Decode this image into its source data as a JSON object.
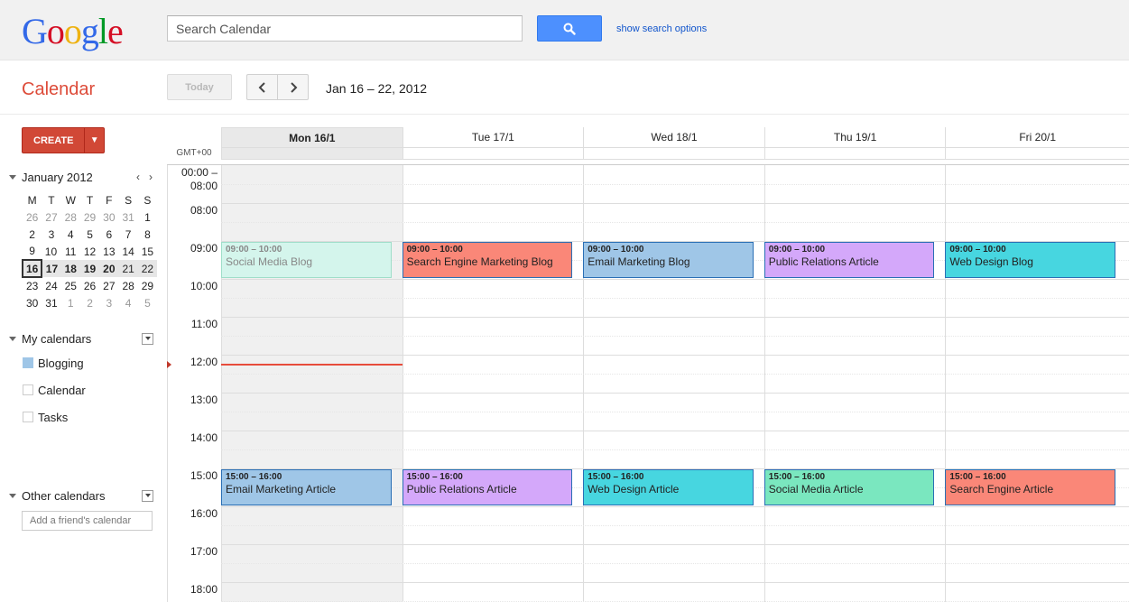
{
  "header": {
    "logo_letters": [
      {
        "ch": "G",
        "color": "#3369e8"
      },
      {
        "ch": "o",
        "color": "#d50f25"
      },
      {
        "ch": "o",
        "color": "#eeb211"
      },
      {
        "ch": "g",
        "color": "#3369e8"
      },
      {
        "ch": "l",
        "color": "#009925"
      },
      {
        "ch": "e",
        "color": "#d50f25"
      }
    ],
    "search_placeholder": "Search Calendar",
    "search_icon": "search-icon",
    "search_options_label": "show search options"
  },
  "toolbar": {
    "app_title": "Calendar",
    "today_label": "Today",
    "prev_icon": "chevron-left-icon",
    "next_icon": "chevron-right-icon",
    "date_range": "Jan 16 – 22, 2012"
  },
  "sidebar": {
    "create_label": "CREATE",
    "mini_calendar": {
      "title": "January 2012",
      "dows": [
        "M",
        "T",
        "W",
        "T",
        "F",
        "S",
        "S"
      ],
      "weeks": [
        [
          {
            "d": "26",
            "o": true
          },
          {
            "d": "27",
            "o": true
          },
          {
            "d": "28",
            "o": true
          },
          {
            "d": "29",
            "o": true
          },
          {
            "d": "30",
            "o": true
          },
          {
            "d": "31",
            "o": true
          },
          {
            "d": "1"
          }
        ],
        [
          {
            "d": "2"
          },
          {
            "d": "3"
          },
          {
            "d": "4"
          },
          {
            "d": "5"
          },
          {
            "d": "6"
          },
          {
            "d": "7"
          },
          {
            "d": "8"
          }
        ],
        [
          {
            "d": "9"
          },
          {
            "d": "10"
          },
          {
            "d": "11"
          },
          {
            "d": "12"
          },
          {
            "d": "13"
          },
          {
            "d": "14"
          },
          {
            "d": "15"
          }
        ],
        [
          {
            "d": "16",
            "today": true
          },
          {
            "d": "17"
          },
          {
            "d": "18"
          },
          {
            "d": "19"
          },
          {
            "d": "20"
          },
          {
            "d": "21"
          },
          {
            "d": "22"
          }
        ],
        [
          {
            "d": "23"
          },
          {
            "d": "24"
          },
          {
            "d": "25"
          },
          {
            "d": "26"
          },
          {
            "d": "27"
          },
          {
            "d": "28"
          },
          {
            "d": "29"
          }
        ],
        [
          {
            "d": "30"
          },
          {
            "d": "31"
          },
          {
            "d": "1",
            "o": true
          },
          {
            "d": "2",
            "o": true
          },
          {
            "d": "3",
            "o": true
          },
          {
            "d": "4",
            "o": true
          },
          {
            "d": "5",
            "o": true
          }
        ]
      ]
    },
    "my_calendars_title": "My calendars",
    "my_calendars": [
      {
        "label": "Blogging",
        "color": "#9fc6e7"
      },
      {
        "label": "Calendar",
        "color": "#ffffff"
      },
      {
        "label": "Tasks",
        "color": "#ffffff"
      }
    ],
    "other_calendars_title": "Other calendars",
    "friend_placeholder": "Add a friend's calendar"
  },
  "grid": {
    "timezone": "GMT+00",
    "days": [
      "Mon 16/1",
      "Tue 17/1",
      "Wed 18/1",
      "Thu 19/1",
      "Fri 20/1"
    ],
    "active_day": 0,
    "hours": [
      "00:00 –\n08:00",
      "08:00",
      "09:00",
      "10:00",
      "11:00",
      "12:00",
      "13:00",
      "14:00",
      "15:00",
      "16:00",
      "17:00",
      "18:00"
    ],
    "now_hour": 12.25,
    "events": [
      {
        "day": 0,
        "start": 9,
        "time": "09:00 – 10:00",
        "title": "Social Media Blog",
        "bg": "#d4f5ec",
        "border": "#9fdec9",
        "past": true
      },
      {
        "day": 1,
        "start": 9,
        "time": "09:00 – 10:00",
        "title": "Search Engine Marketing Blog",
        "bg": "#fa8778",
        "border": "#2a6fb5"
      },
      {
        "day": 2,
        "start": 9,
        "time": "09:00 – 10:00",
        "title": "Email Marketing Blog",
        "bg": "#9fc6e7",
        "border": "#2a6fb5"
      },
      {
        "day": 3,
        "start": 9,
        "time": "09:00 – 10:00",
        "title": "Public Relations Article",
        "bg": "#d4a8fa",
        "border": "#2a6fb5"
      },
      {
        "day": 4,
        "start": 9,
        "time": "09:00 – 10:00",
        "title": "Web Design Blog",
        "bg": "#47d6e0",
        "border": "#2a6fb5"
      },
      {
        "day": 0,
        "start": 15,
        "time": "15:00 – 16:00",
        "title": "Email Marketing Article",
        "bg": "#9fc6e7",
        "border": "#2a6fb5"
      },
      {
        "day": 1,
        "start": 15,
        "time": "15:00 – 16:00",
        "title": "Public Relations Article",
        "bg": "#d4a8fa",
        "border": "#2a6fb5"
      },
      {
        "day": 2,
        "start": 15,
        "time": "15:00 – 16:00",
        "title": "Web Design Article",
        "bg": "#47d6e0",
        "border": "#2a6fb5"
      },
      {
        "day": 3,
        "start": 15,
        "time": "15:00 – 16:00",
        "title": "Social Media Article",
        "bg": "#7ae7bf",
        "border": "#2a6fb5"
      },
      {
        "day": 4,
        "start": 15,
        "time": "15:00 – 16:00",
        "title": "Search Engine Article",
        "bg": "#fa8778",
        "border": "#2a6fb5"
      }
    ]
  }
}
